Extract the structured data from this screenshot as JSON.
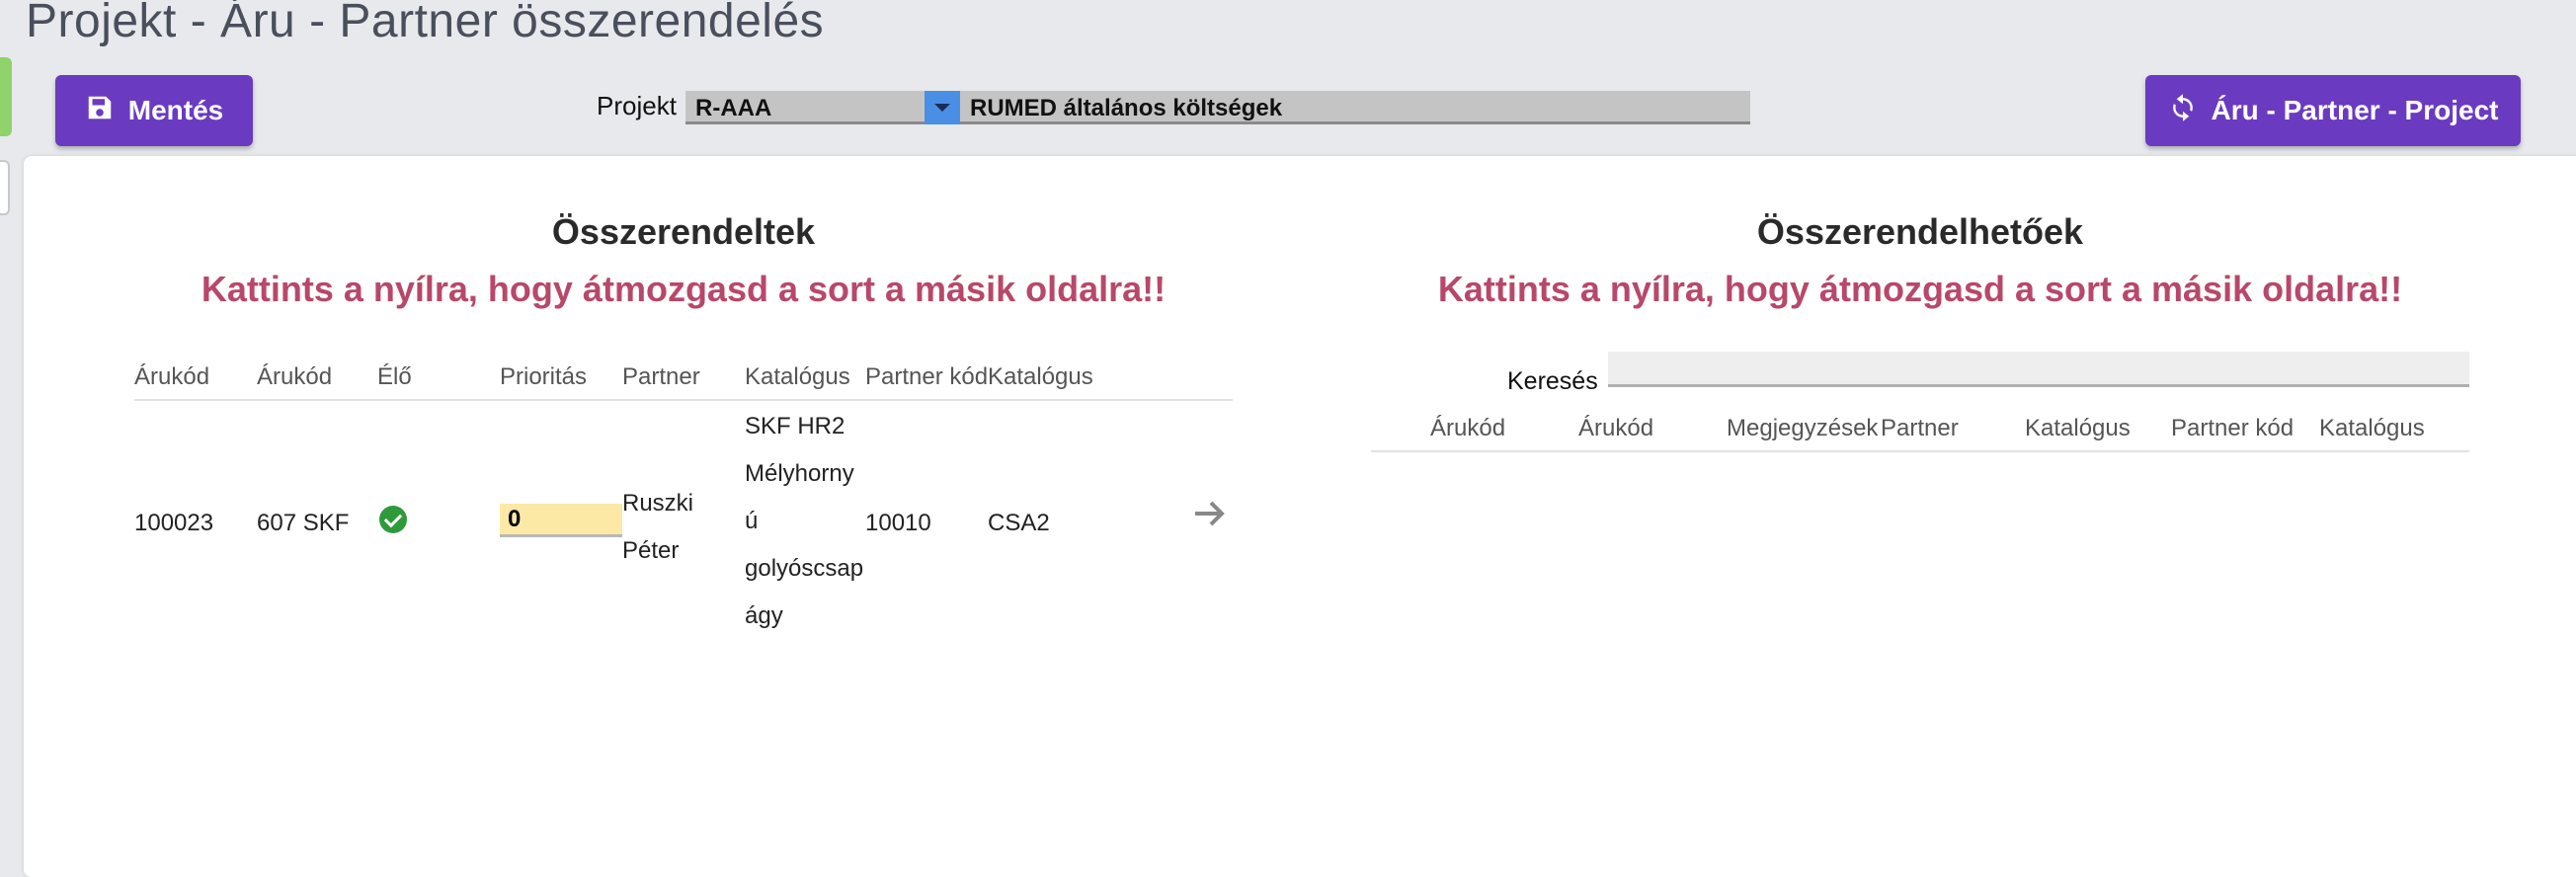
{
  "page": {
    "title": "Projekt - Áru - Partner összerendelés"
  },
  "toolbar": {
    "save_label": "Mentés",
    "save_icon": "floppy-disk-icon",
    "sync_label": "Áru - Partner - Project",
    "sync_icon": "refresh-icon",
    "button_color": "#6a3bc0"
  },
  "project_filter": {
    "label": "Projekt",
    "code": "R-AAA",
    "name": "RUMED általános költségek"
  },
  "assigned": {
    "title": "Összerendeltek",
    "hint": "Kattints a nyílra, hogy átmozgasd a sort a másik oldalra!!",
    "columns": [
      "Árukód",
      "Árukód",
      "Élő",
      "Prioritás",
      "Partner",
      "Katalógus",
      "Partner kód",
      "Katalógus"
    ],
    "rows": [
      {
        "code1": "100023",
        "code2": "607 SKF",
        "live_icon": "check-circle-icon",
        "priority": "0",
        "partner": [
          "Ruszki",
          "Péter"
        ],
        "catalog": [
          "SKF HR2",
          "Mélyhorny",
          "ú",
          "golyóscsap",
          "ágy"
        ],
        "partner_code": "10010",
        "catalog2": "CSA2",
        "move_icon": "arrow-right-icon"
      }
    ]
  },
  "available": {
    "title": "Összerendelhetőek",
    "hint": "Kattints a nyílra, hogy átmozgasd a sort a másik oldalra!!",
    "search_label": "Keresés",
    "search_value": "",
    "columns": [
      "Árukód",
      "Árukód",
      "Megjegyzések",
      "Partner",
      "Katalógus",
      "Partner kód",
      "Katalógus"
    ]
  },
  "colors": {
    "hint": "#b8486a",
    "priority_bg": "#fde9a6",
    "live_ok": "#2e9a3a"
  }
}
